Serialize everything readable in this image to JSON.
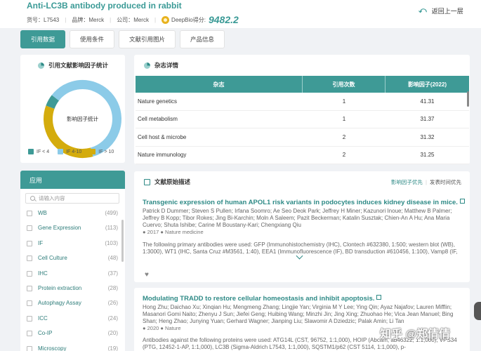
{
  "header": {
    "title": "Anti-LC3B antibody produced in rabbit",
    "catalog_label": "货号：",
    "catalog_value": "L7543",
    "brand_label": "品牌：",
    "brand_value": "Merck",
    "company_label": "公司：",
    "company_value": "Merck",
    "score_label": "DeepBio得分:",
    "score_value": "9482.2",
    "back_label": "返回上一层"
  },
  "tabs": [
    {
      "label": "引用数据",
      "active": true
    },
    {
      "label": "使用条件",
      "active": false
    },
    {
      "label": "文献引用图片",
      "active": false
    },
    {
      "label": "产品信息",
      "active": false
    }
  ],
  "impact": {
    "title": "引用文献影响因子统计",
    "center_label": "影响因子统计",
    "segments": [
      {
        "name": "IF < 4",
        "value": 5,
        "color": "#3e9a96"
      },
      {
        "name": "IF 4-10",
        "value": 60,
        "color": "#8ccbe8"
      },
      {
        "name": "IF > 10",
        "value": 35,
        "color": "#d4ac0d"
      }
    ]
  },
  "applications": {
    "header": "应用",
    "search_placeholder": "请输入内容",
    "items": [
      {
        "label": "WB",
        "count": "(499)"
      },
      {
        "label": "Gene Expression",
        "count": "(113)"
      },
      {
        "label": "IF",
        "count": "(103)"
      },
      {
        "label": "Cell Culture",
        "count": "(48)"
      },
      {
        "label": "IHC",
        "count": "(37)"
      },
      {
        "label": "Protein extraction",
        "count": "(28)"
      },
      {
        "label": "Autophagy Assay",
        "count": "(26)"
      },
      {
        "label": "ICC",
        "count": "(24)"
      },
      {
        "label": "Co-IP",
        "count": "(20)"
      },
      {
        "label": "Microscopy",
        "count": "(19)"
      }
    ]
  },
  "journals": {
    "title": "杂志详情",
    "columns": [
      "杂志",
      "引用次数",
      "影响因子(2022)"
    ],
    "rows": [
      [
        "Nature genetics",
        "1",
        "41.31"
      ],
      [
        "Cell metabolism",
        "1",
        "31.37"
      ],
      [
        "Cell host & microbe",
        "2",
        "31.32"
      ],
      [
        "Nature immunology",
        "2",
        "31.25"
      ]
    ]
  },
  "literature": {
    "title": "文献原始描述",
    "sort_impact": "影响因子优先",
    "sort_divider": "|",
    "sort_date": "发表时间优先",
    "articles": [
      {
        "title": "Transgenic expression of human APOL1 risk variants in podocytes induces kidney disease in mice.",
        "authors": "Patrick D Dummer; Steven S Pullen; Irfana Soomro; Ae Seo Deok Park; Jeffrey H Miner; Kazunori Inoue; Matthew B Palmer; Jeffrey B Kopp; Tibor Rokes; Jing Bi-Karchin; Moln A Saleem; Pazit Beckerman; Katalin Susztak; Chien-An A Hu; Ana Maria Cuervo; Shuta Ishibe; Carine M Boustany-Kari; Chengxiang Qiu",
        "year": "2017",
        "journal": "Nature medicine",
        "abstract": "The following primary antibodies were used: GFP (Immunohistochemistry (IHC), Clontech #632380, 1:500; western blot (WB), 1:3000), WT1 (IHC, Santa Cruz #M3561, 1:40), EEA1 (Immunofluorescence (IF), BD transduction #610456, 1:100), Vamp8 (IF,"
      },
      {
        "title": "Modulating TRADD to restore cellular homeostasis and inhibit apoptosis.",
        "authors": "Hong Zhu; Daichao Xu; Xinqian Hu; Mengmeng Zhang; Lingjie Yan; Virginia M Y Lee; Ying Qin; Ayaz Najafov; Lauren Mifflin; Masanori Gomi Naito; Zhenyu J Sun; Jiefei Geng; Huibing Wang; Minzhi Jin; Jing Xing; Zhuohao He; Vica Jean Manuel; Bing Shan; Heng Zhao; Junying Yuan; Gerhard Wagner; Jianping Liu; Slawomir A Dziedzic; Palak Amin; Li Tan",
        "year": "2020",
        "journal": "Nature",
        "abstract": "Antibodies against the following proteins were used: ATG14L (CST, 96752, 1:1,000), HOIP (Abcam, ab46322; 1:1,000), VPS34 (PTG, 12452-1-AP, 1:1,000), LC3B (Sigma-Aldrich L7543, 1:1,000), SQSTM1/p62 (CST 5114, 1:1,000), p-"
      }
    ]
  },
  "watermark": "知乎 @郑倩倩"
}
